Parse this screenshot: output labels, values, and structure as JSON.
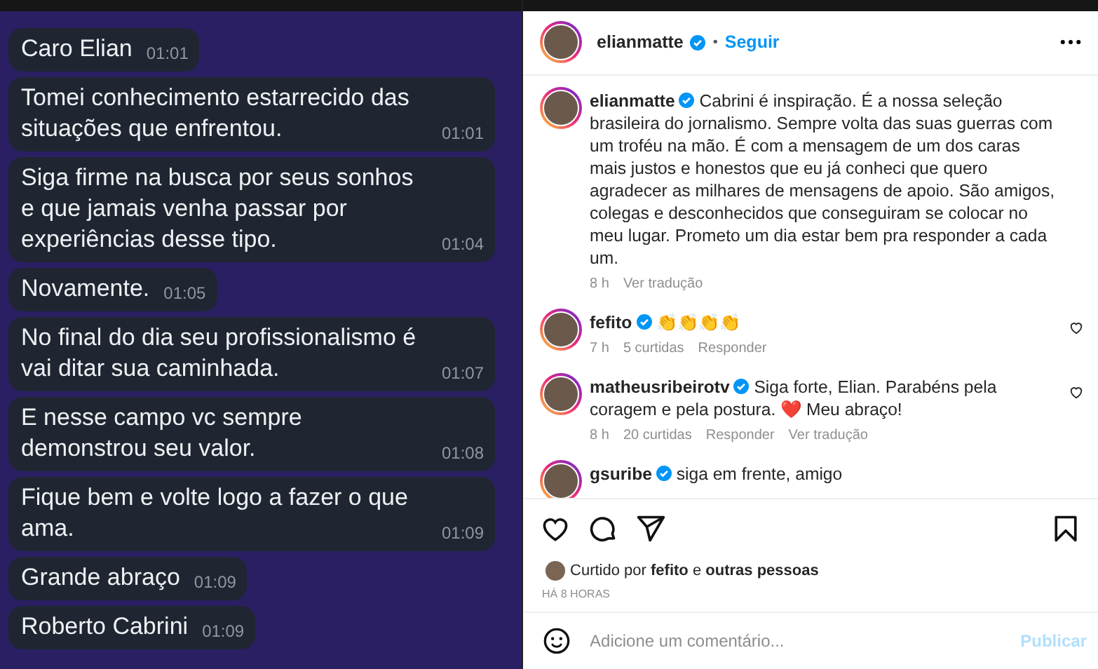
{
  "chat": {
    "messages": [
      {
        "text": "Caro Elian",
        "time": "01:01"
      },
      {
        "text": "Tomei conhecimento estarrecido das situações que enfrentou.",
        "time": "01:01"
      },
      {
        "text": "Siga firme na busca por seus sonhos e que  jamais venha passar por experiências desse tipo.",
        "time": "01:04"
      },
      {
        "text": "Novamente.",
        "time": "01:05"
      },
      {
        "text": "No final do dia seu profissionalismo é vai ditar sua caminhada.",
        "time": "01:07"
      },
      {
        "text": "E nesse campo vc sempre demonstrou seu valor.",
        "time": "01:08"
      },
      {
        "text": "Fique bem e volte logo a fazer o que ama.",
        "time": "01:09"
      },
      {
        "text": "Grande abraço",
        "time": "01:09"
      },
      {
        "text": "Roberto Cabrini",
        "time": "01:09"
      }
    ]
  },
  "post": {
    "author": "elianmatte",
    "verified": true,
    "separator": "•",
    "follow": "Seguir",
    "caption": {
      "author": "elianmatte",
      "verified": true,
      "text": "Cabrini é inspiração. É a nossa seleção brasileira do jornalismo. Sempre volta das suas guerras com um troféu na mão. É com a mensagem de um dos caras mais justos e honestos que eu já conheci que quero agradecer as milhares de mensagens de apoio. São amigos, colegas e desconhecidos que conseguiram se colocar no meu lugar. Prometo um dia estar bem pra responder a cada um.",
      "time": "8 h",
      "translate": "Ver tradução"
    },
    "comments": [
      {
        "author": "fefito",
        "verified": true,
        "text": "👏👏👏👏",
        "time": "7 h",
        "likes": "5 curtidas",
        "reply": "Responder",
        "liked": false
      },
      {
        "author": "matheusribeirotv",
        "verified": true,
        "text": "Siga forte, Elian. Parabéns pela coragem e pela postura. ❤️ Meu abraço!",
        "time": "8 h",
        "likes": "20 curtidas",
        "reply": "Responder",
        "translate": "Ver tradução",
        "liked": false
      },
      {
        "author": "gsuribe",
        "verified": true,
        "text": "siga em frente, amigo"
      }
    ],
    "liked_by": {
      "prefix": "Curtido por",
      "user": "fefito",
      "joiner": "e",
      "others": "outras pessoas"
    },
    "timestamp": "HÁ 8 HORAS",
    "comment_field": {
      "placeholder": "Adicione um comentário...",
      "submit": "Publicar",
      "submit_disabled": true
    }
  }
}
